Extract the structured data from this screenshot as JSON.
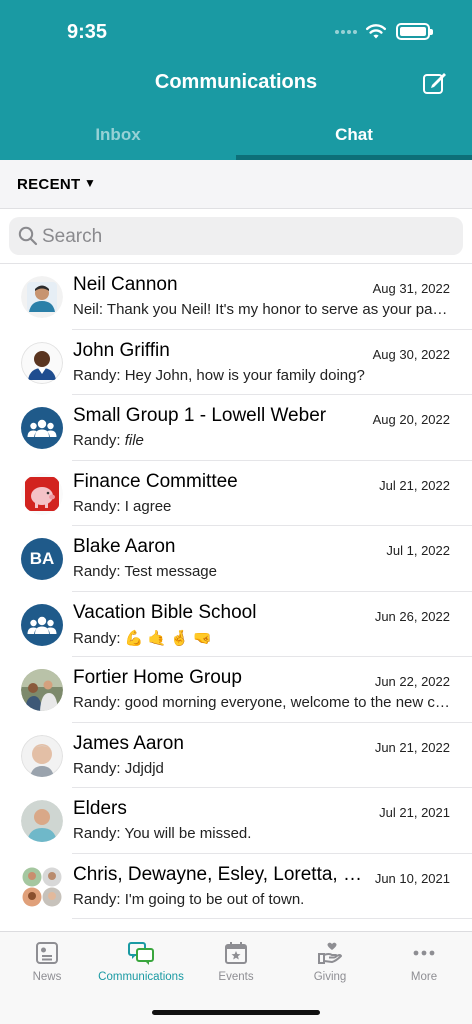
{
  "status_bar": {
    "time": "9:35"
  },
  "header": {
    "title": "Communications",
    "compose_icon": "compose-icon"
  },
  "tabs": [
    {
      "label": "Inbox",
      "selected": false
    },
    {
      "label": "Chat",
      "selected": true
    }
  ],
  "filter": {
    "label": "RECENT",
    "caret": "▼"
  },
  "search": {
    "placeholder": "Search"
  },
  "conversations": [
    {
      "name": "Neil Cannon",
      "date": "Aug 31, 2022",
      "sender": "Neil: ",
      "message": "Thank you Neil! It's my honor to serve as your pas…",
      "avatar": "photo"
    },
    {
      "name": "John Griffin",
      "date": "Aug 30, 2022",
      "sender": "Randy: ",
      "message": "Hey John, how is your family doing?",
      "avatar": "photo"
    },
    {
      "name": "Small Group 1 - Lowell Weber",
      "date": "Aug 20, 2022",
      "sender": "Randy: ",
      "message": "file",
      "avatar": "group-icon"
    },
    {
      "name": "Finance Committee",
      "date": "Jul 21, 2022",
      "sender": "Randy: ",
      "message": "I agree",
      "avatar": "piggy-bank-photo"
    },
    {
      "name": "Blake Aaron",
      "date": "Jul 1, 2022",
      "sender": "Randy: ",
      "message": "Test message",
      "avatar": "initials",
      "initials": "BA"
    },
    {
      "name": "Vacation Bible School",
      "date": "Jun 26, 2022",
      "sender": "Randy: ",
      "message": "💪 🤙 🤞 🤜",
      "avatar": "group-icon"
    },
    {
      "name": "Fortier Home Group",
      "date": "Jun 22, 2022",
      "sender": "Randy: ",
      "message": "good morning everyone, welcome to the new c…",
      "avatar": "photo"
    },
    {
      "name": "James Aaron",
      "date": "Jun 21, 2022",
      "sender": "Randy: ",
      "message": "Jdjdjd",
      "avatar": "photo"
    },
    {
      "name": "Elders",
      "date": "Jul 21, 2021",
      "sender": "Randy: ",
      "message": "You will be missed.",
      "avatar": "photo"
    },
    {
      "name": "Chris, Dewayne, Esley, Loretta, R…",
      "date": "Jun 10, 2021",
      "sender": "Randy: ",
      "message": "I'm going to be out of town.",
      "avatar": "photo-collage"
    }
  ],
  "tabbar": [
    {
      "label": "News",
      "icon": "news-icon",
      "active": false
    },
    {
      "label": "Communications",
      "icon": "communications-icon",
      "active": true
    },
    {
      "label": "Events",
      "icon": "events-icon",
      "active": false
    },
    {
      "label": "Giving",
      "icon": "giving-icon",
      "active": false
    },
    {
      "label": "More",
      "icon": "more-icon",
      "active": false
    }
  ],
  "colors": {
    "brand": "#1a9aa3",
    "brand_dark": "#0d6f78",
    "avatar_blue": "#1f5a8a"
  }
}
